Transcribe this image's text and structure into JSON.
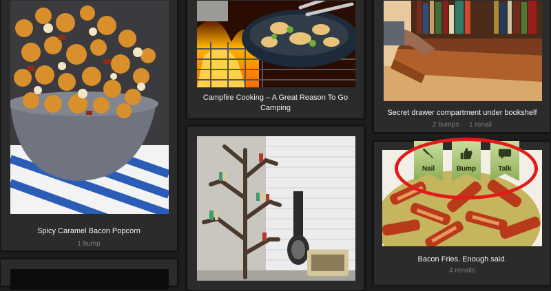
{
  "pins": [
    {
      "title": "Spicy Caramel Bacon Popcorn",
      "stats": [
        "1 bump"
      ]
    },
    {
      "title": "Campfire Cooking – A Great Reason To Go Camping",
      "stats": []
    },
    {
      "title": "Secret drawer compartment under bookshelf",
      "stats": [
        "2 bumps",
        "1 renail"
      ]
    },
    {
      "title": "",
      "stats": []
    },
    {
      "title": "Bacon Fries. Enough said.",
      "stats": [
        "4 renails"
      ]
    }
  ],
  "actions": [
    {
      "label": "Nail",
      "icon": "nail-icon"
    },
    {
      "label": "Bump",
      "icon": "thumbs-up-icon"
    },
    {
      "label": "Talk",
      "icon": "speech-bubble-icon"
    }
  ],
  "colors": {
    "accent_green": "#a9c46e",
    "highlight_ring": "#e21a1a",
    "background": "#1e1e1e"
  }
}
